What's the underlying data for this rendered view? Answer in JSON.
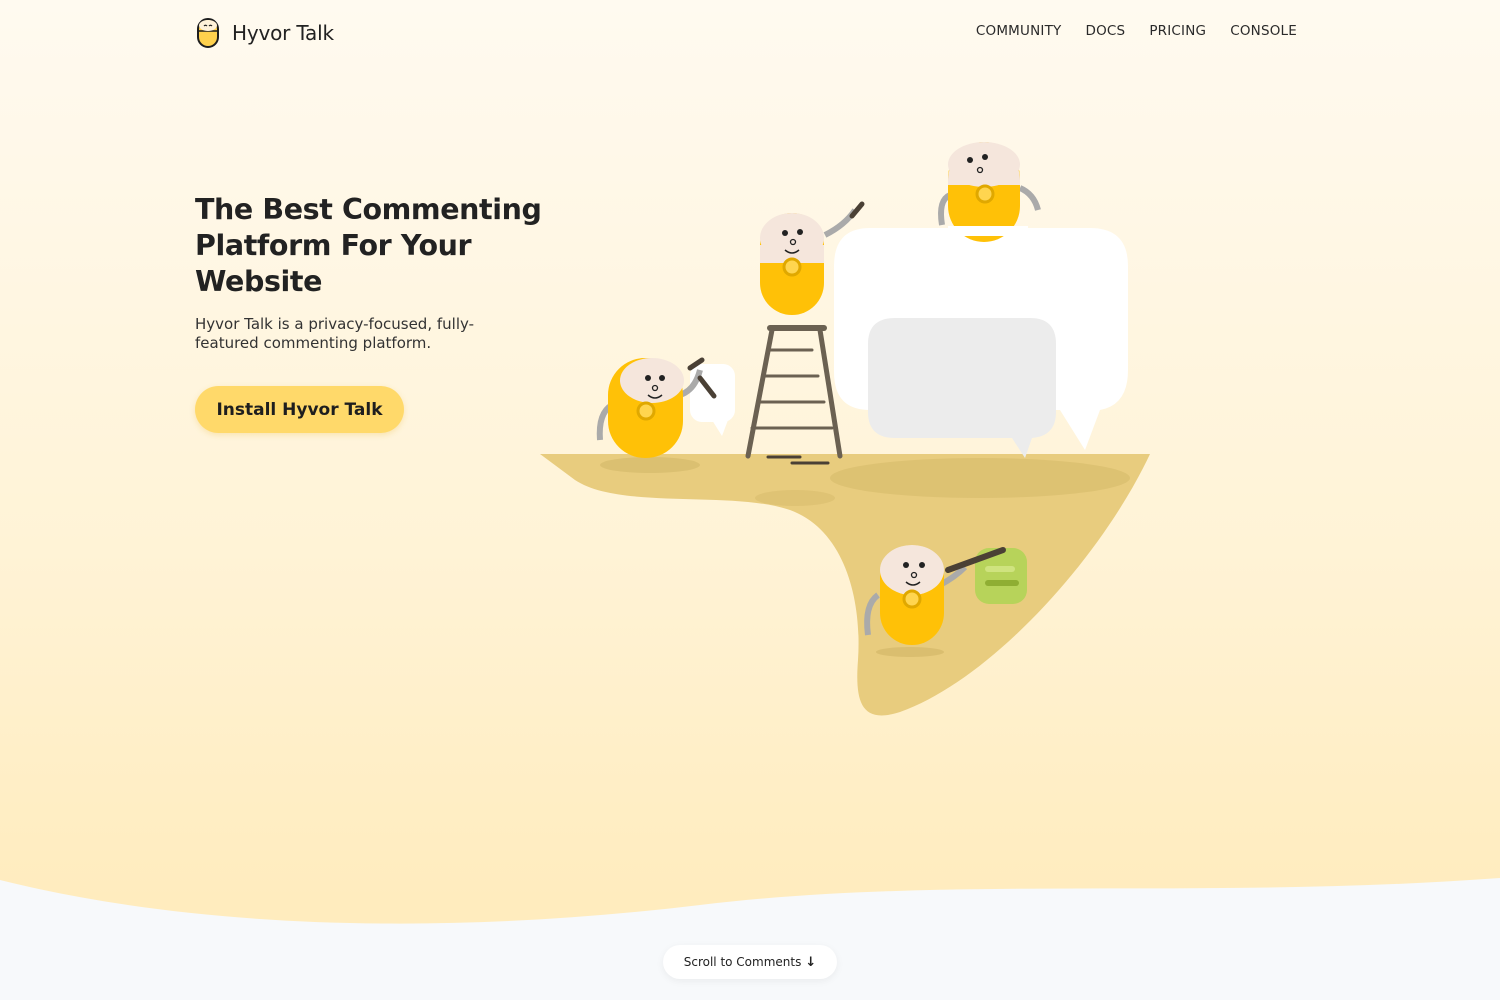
{
  "app": {
    "logo_text": "Hyvor Talk",
    "logo_icon": "hyvor-mascot-icon"
  },
  "nav": {
    "items": [
      {
        "label": "COMMUNITY"
      },
      {
        "label": "DOCS"
      },
      {
        "label": "PRICING"
      },
      {
        "label": "CONSOLE"
      }
    ]
  },
  "hero": {
    "title": "The Best Commenting Platform For Your Website",
    "subtitle": "Hyvor Talk is a privacy-focused, fully-featured commenting platform.",
    "cta_label": "Install Hyvor Talk"
  },
  "scroll": {
    "label": "Scroll to Comments",
    "icon": "arrow-down-icon"
  },
  "colors": {
    "accent": "#ffd96a",
    "mascot_body": "#ffc107",
    "ground": "#e8cc7e",
    "background_bottom": "#f7f9fb"
  }
}
